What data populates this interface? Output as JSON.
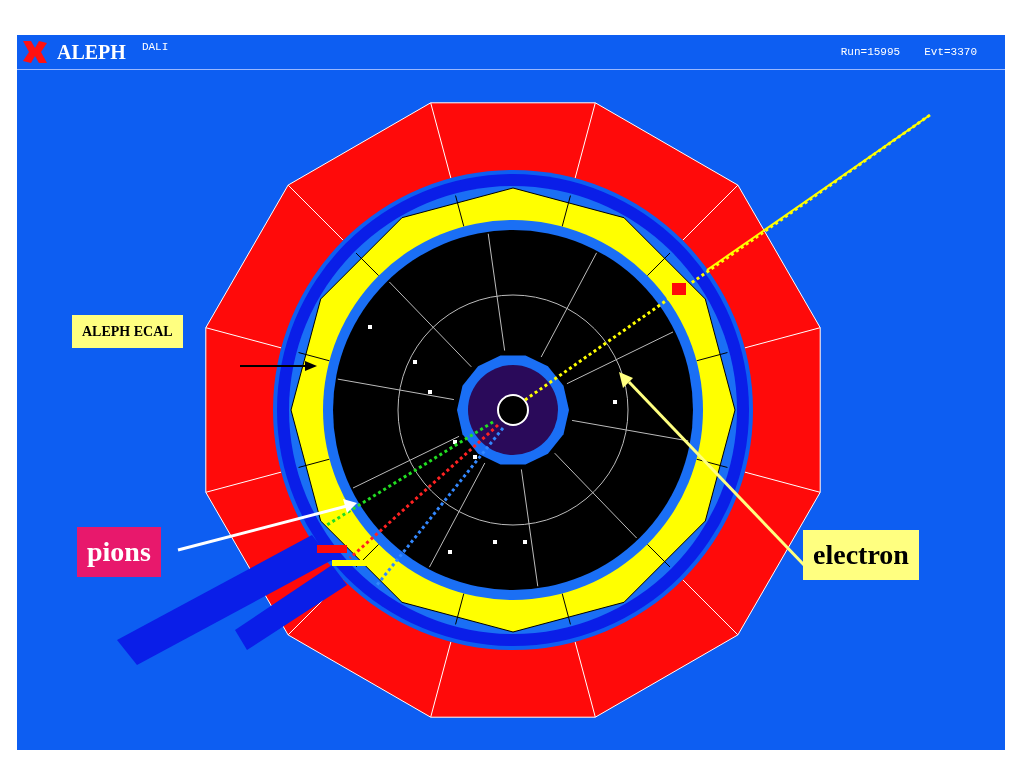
{
  "header": {
    "logo_text": "ALEPH",
    "program": "DALI",
    "run": "Run=15995",
    "event": "Evt=3370"
  },
  "annotations": [
    {
      "text": "ALEPH ECAL",
      "kind": "small",
      "color": "#ffff80"
    },
    {
      "text": "pions",
      "kind": "large",
      "color": "#e8186c"
    },
    {
      "text": "electron",
      "kind": "large",
      "color": "#ffff80"
    }
  ]
}
